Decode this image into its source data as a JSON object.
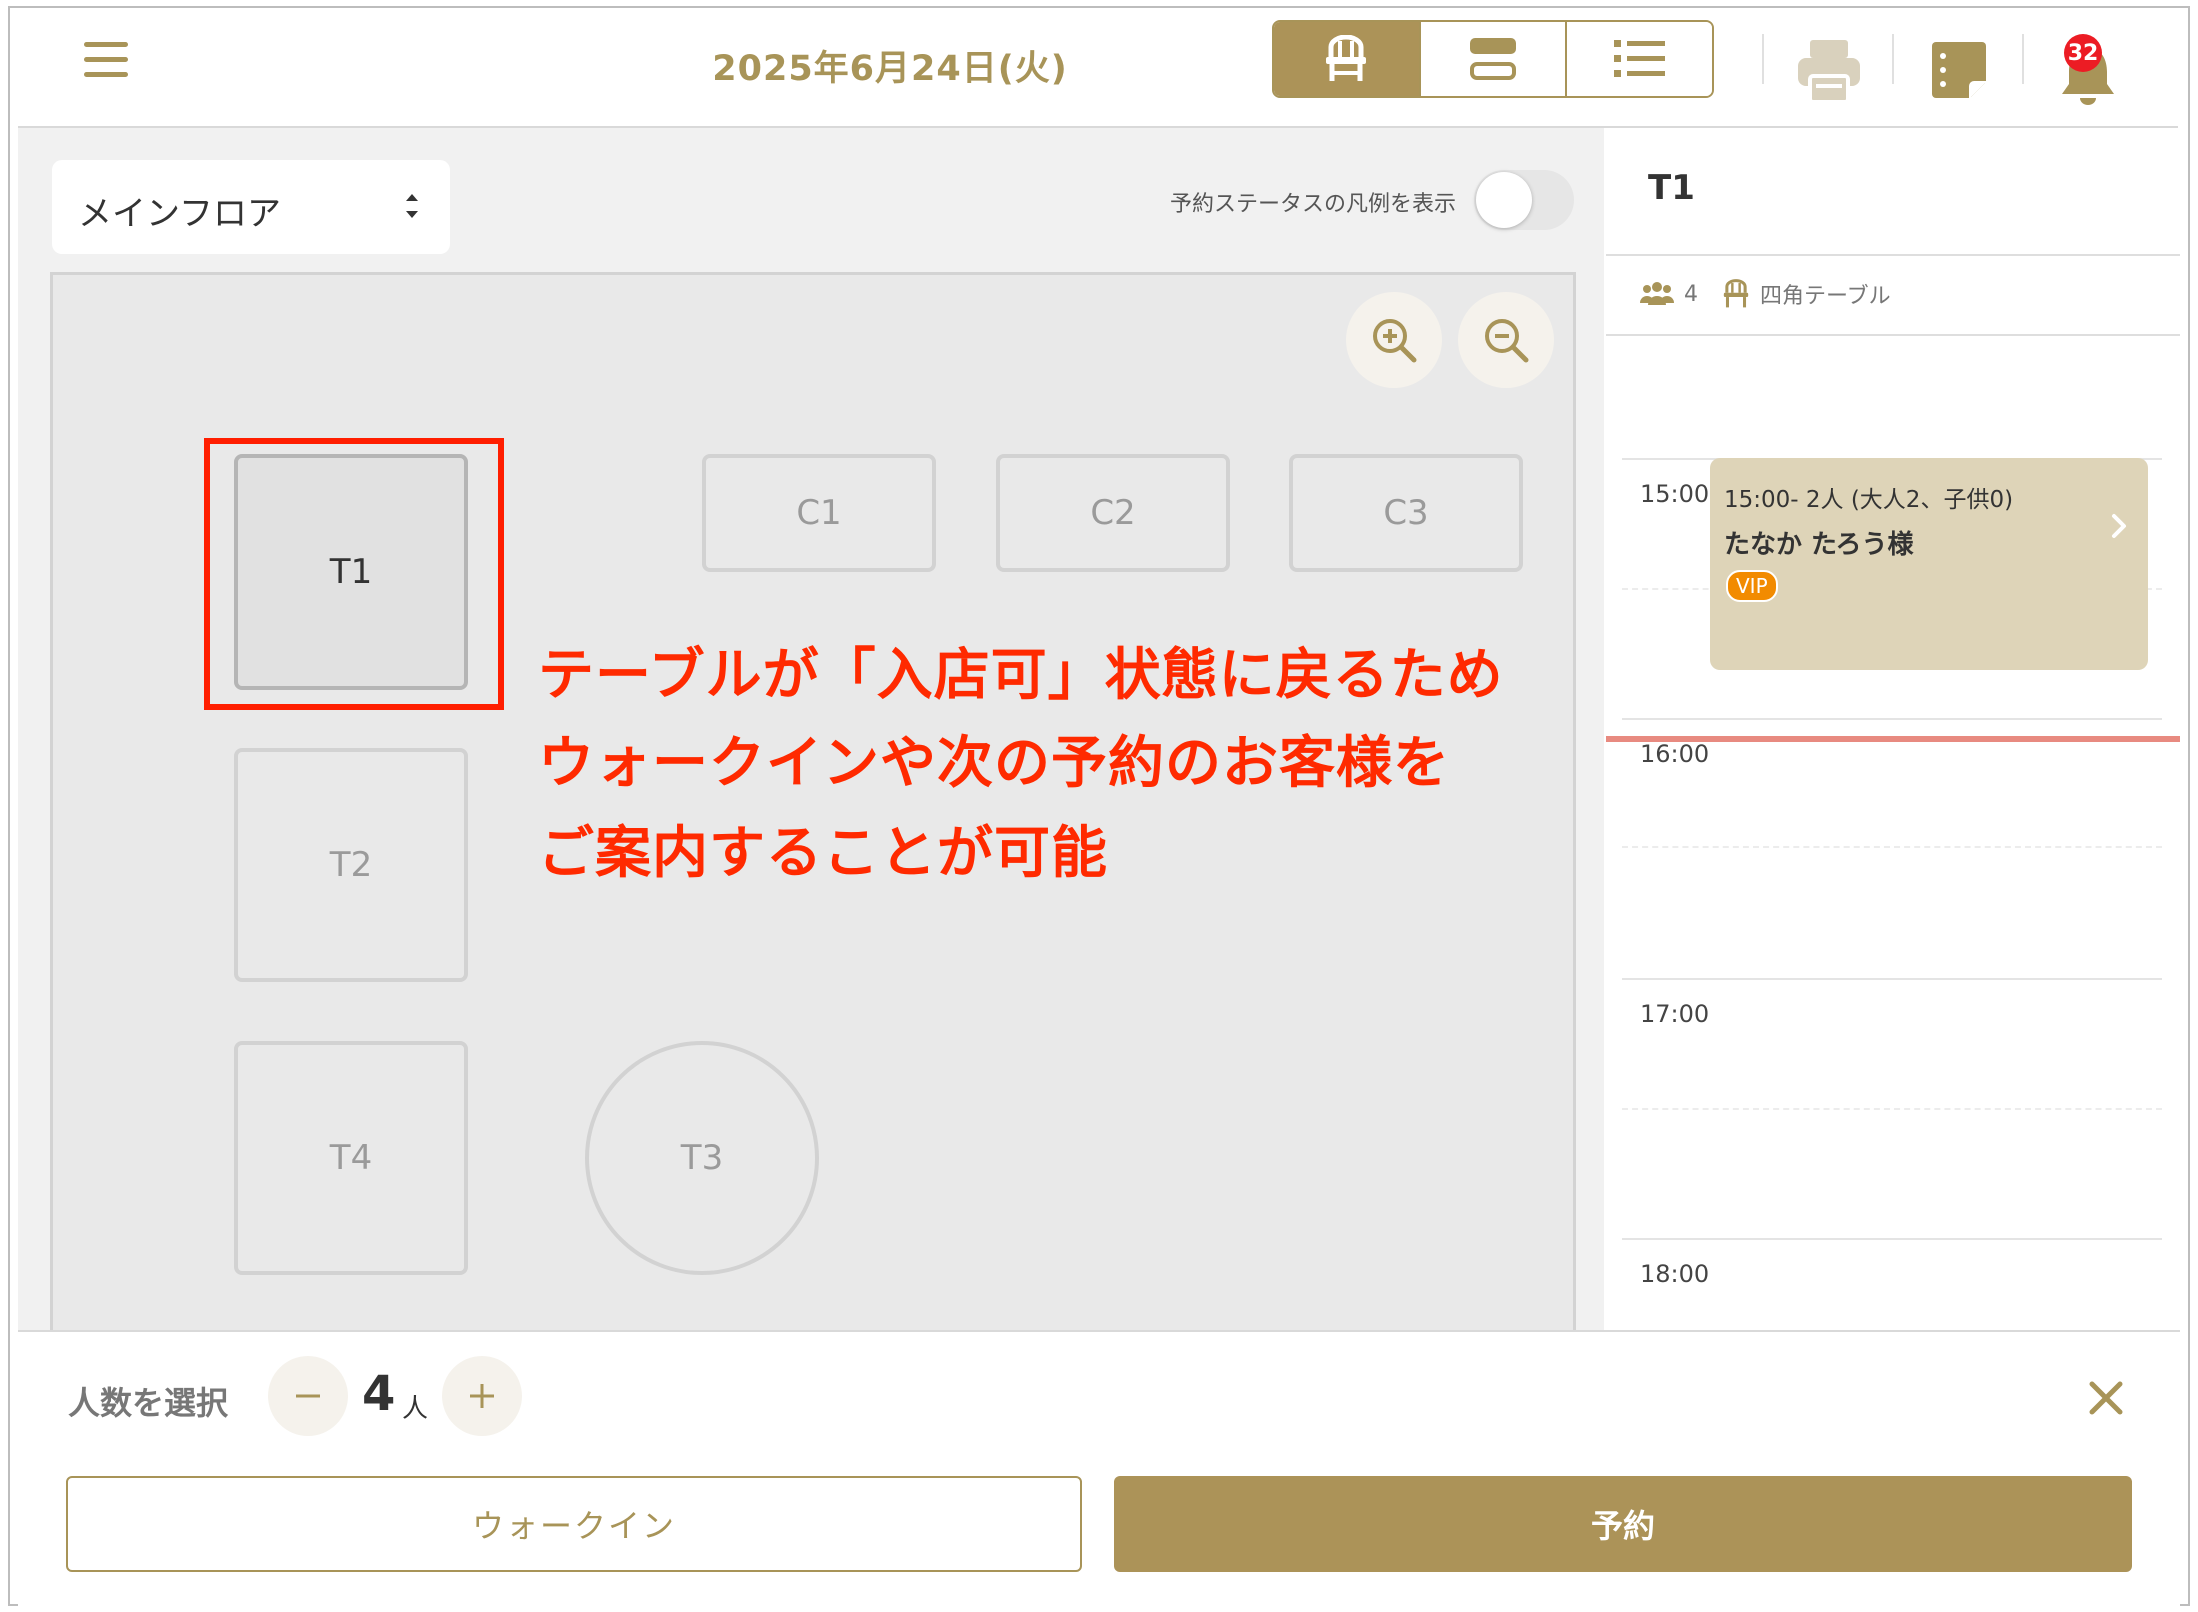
{
  "header": {
    "date": "2025年6月24日(火)",
    "view_tabs": [
      {
        "icon": "chair-icon",
        "active": true
      },
      {
        "icon": "layout-rows-icon",
        "active": false
      },
      {
        "icon": "list-icon",
        "active": false
      }
    ],
    "notification_count": "32"
  },
  "floor": {
    "selected": "メインフロア",
    "legend_toggle_label": "予約ステータスの凡例を表示",
    "legend_toggle_on": false,
    "tables": [
      {
        "id": "T1",
        "label": "T1",
        "shape": "square",
        "selected": true
      },
      {
        "id": "C1",
        "label": "C1",
        "shape": "rect",
        "selected": false
      },
      {
        "id": "C2",
        "label": "C2",
        "shape": "rect",
        "selected": false
      },
      {
        "id": "C3",
        "label": "C3",
        "shape": "rect",
        "selected": false
      },
      {
        "id": "T2",
        "label": "T2",
        "shape": "square",
        "selected": false
      },
      {
        "id": "T4",
        "label": "T4",
        "shape": "square",
        "selected": false
      },
      {
        "id": "T3",
        "label": "T3",
        "shape": "round",
        "selected": false
      }
    ]
  },
  "annotation": {
    "line1": "テーブルが「入店可」状態に戻るため",
    "line2": "ウォークインや次の予約のお客様を",
    "line3": "ご案内することが可能",
    "color": "#ff2a00"
  },
  "side": {
    "table_name": "T1",
    "capacity": "4",
    "table_type": "四角テーブル",
    "times": [
      "15:00",
      "16:00",
      "17:00",
      "18:00"
    ],
    "reservation": {
      "time_and_party": "15:00-  2人 (大人2、子供0)",
      "guest": "たなか たろう様",
      "tag": "VIP"
    }
  },
  "bottom": {
    "count_label": "人数を選択",
    "count": "4",
    "unit": "人",
    "walkin_label": "ウォークイン",
    "reserve_label": "予約"
  },
  "colors": {
    "accent": "#ac9358",
    "accent_text": "#a89458",
    "badge": "#ec1c24",
    "reservation_card": "#ded4b8",
    "now_line": "#e88a80",
    "vip": "#f28b00"
  }
}
